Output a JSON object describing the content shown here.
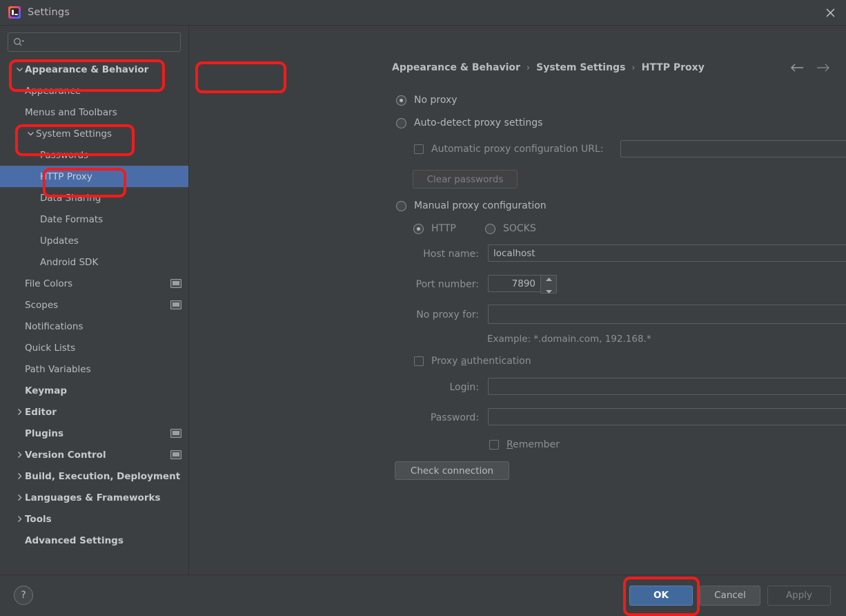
{
  "window": {
    "title": "Settings",
    "app_icon": "intellij-idea-icon",
    "close_icon": "close-icon"
  },
  "sidebar": {
    "search": {
      "placeholder": "",
      "value": "",
      "icon": "search-icon",
      "dropdown_icon": "chevron-down-icon"
    },
    "items": [
      {
        "label": "Appearance & Behavior",
        "level": 0,
        "bold": true,
        "twisty": "expanded",
        "selected": false,
        "trailing_icon": null
      },
      {
        "label": "Appearance",
        "level": 1,
        "bold": false,
        "twisty": "none",
        "selected": false,
        "trailing_icon": null
      },
      {
        "label": "Menus and Toolbars",
        "level": 1,
        "bold": false,
        "twisty": "none",
        "selected": false,
        "trailing_icon": null
      },
      {
        "label": "System Settings",
        "level": 1,
        "bold": false,
        "twisty": "expanded",
        "selected": false,
        "trailing_icon": null
      },
      {
        "label": "Passwords",
        "level": 2,
        "bold": false,
        "twisty": "none",
        "selected": false,
        "trailing_icon": null
      },
      {
        "label": "HTTP Proxy",
        "level": 2,
        "bold": false,
        "twisty": "none",
        "selected": true,
        "trailing_icon": null
      },
      {
        "label": "Data Sharing",
        "level": 2,
        "bold": false,
        "twisty": "none",
        "selected": false,
        "trailing_icon": null
      },
      {
        "label": "Date Formats",
        "level": 2,
        "bold": false,
        "twisty": "none",
        "selected": false,
        "trailing_icon": null
      },
      {
        "label": "Updates",
        "level": 2,
        "bold": false,
        "twisty": "none",
        "selected": false,
        "trailing_icon": null
      },
      {
        "label": "Android SDK",
        "level": 2,
        "bold": false,
        "twisty": "none",
        "selected": false,
        "trailing_icon": null
      },
      {
        "label": "File Colors",
        "level": 1,
        "bold": false,
        "twisty": "none",
        "selected": false,
        "trailing_icon": "monitor-icon"
      },
      {
        "label": "Scopes",
        "level": 1,
        "bold": false,
        "twisty": "none",
        "selected": false,
        "trailing_icon": "monitor-icon"
      },
      {
        "label": "Notifications",
        "level": 1,
        "bold": false,
        "twisty": "none",
        "selected": false,
        "trailing_icon": null
      },
      {
        "label": "Quick Lists",
        "level": 1,
        "bold": false,
        "twisty": "none",
        "selected": false,
        "trailing_icon": null
      },
      {
        "label": "Path Variables",
        "level": 1,
        "bold": false,
        "twisty": "none",
        "selected": false,
        "trailing_icon": null
      },
      {
        "label": "Keymap",
        "level": 0,
        "bold": true,
        "twisty": "none",
        "selected": false,
        "trailing_icon": null
      },
      {
        "label": "Editor",
        "level": 0,
        "bold": true,
        "twisty": "collapsed",
        "selected": false,
        "trailing_icon": null
      },
      {
        "label": "Plugins",
        "level": 0,
        "bold": true,
        "twisty": "none",
        "selected": false,
        "trailing_icon": "monitor-icon"
      },
      {
        "label": "Version Control",
        "level": 0,
        "bold": true,
        "twisty": "collapsed",
        "selected": false,
        "trailing_icon": "monitor-icon"
      },
      {
        "label": "Build, Execution, Deployment",
        "level": 0,
        "bold": true,
        "twisty": "collapsed",
        "selected": false,
        "trailing_icon": null
      },
      {
        "label": "Languages & Frameworks",
        "level": 0,
        "bold": true,
        "twisty": "collapsed",
        "selected": false,
        "trailing_icon": null
      },
      {
        "label": "Tools",
        "level": 0,
        "bold": true,
        "twisty": "collapsed",
        "selected": false,
        "trailing_icon": null
      },
      {
        "label": "Advanced Settings",
        "level": 0,
        "bold": true,
        "twisty": "none",
        "selected": false,
        "trailing_icon": null
      }
    ]
  },
  "main": {
    "breadcrumb": [
      "Appearance & Behavior",
      "System Settings",
      "HTTP Proxy"
    ],
    "breadcrumb_separator": "›",
    "nav": {
      "back_icon": "arrow-left-icon",
      "forward_icon": "arrow-right-icon"
    },
    "options": {
      "no_proxy": {
        "label": "No proxy",
        "selected": true
      },
      "auto_detect": {
        "label": "Auto-detect proxy settings",
        "selected": false
      },
      "auto_config_url": {
        "label": "Automatic proxy configuration URL:",
        "checked": false,
        "value": ""
      },
      "clear_passwords": {
        "label": "Clear passwords",
        "enabled": false
      },
      "manual": {
        "label": "Manual proxy configuration",
        "selected": false
      },
      "protocol": {
        "http": {
          "label": "HTTP",
          "selected": true
        },
        "socks": {
          "label": "SOCKS",
          "selected": false
        }
      },
      "host_name": {
        "label": "Host name:",
        "value": "localhost"
      },
      "port_number": {
        "label": "Port number:",
        "value": "7890",
        "spinner_up_icon": "chevron-up-icon",
        "spinner_down_icon": "chevron-down-icon"
      },
      "no_proxy_for": {
        "label": "No proxy for:",
        "value": "",
        "expand_icon": "expand-icon"
      },
      "example_hint": "Example: *.domain.com, 192.168.*",
      "proxy_auth": {
        "label": "Proxy authentication",
        "checked": false
      },
      "login": {
        "label": "Login:",
        "value": ""
      },
      "password": {
        "label": "Password:",
        "value": ""
      },
      "remember": {
        "label": "Remember",
        "checked": false
      },
      "check_connection": {
        "label": "Check connection"
      }
    }
  },
  "footer": {
    "help": {
      "label": "?",
      "icon": "help-icon"
    },
    "ok": "OK",
    "cancel": "Cancel",
    "apply": "Apply"
  },
  "annotations": {
    "color": "#f51a1a",
    "boxes": [
      {
        "name": "appearance-behavior-highlight"
      },
      {
        "name": "system-settings-highlight"
      },
      {
        "name": "http-proxy-highlight"
      },
      {
        "name": "no-proxy-highlight"
      },
      {
        "name": "ok-button-highlight"
      }
    ]
  },
  "colors": {
    "background": "#3c3f41",
    "selection": "#4a6da8",
    "accent_ok": "#41699c",
    "annotation": "#f51a1a",
    "text": "#b3b8bc"
  }
}
